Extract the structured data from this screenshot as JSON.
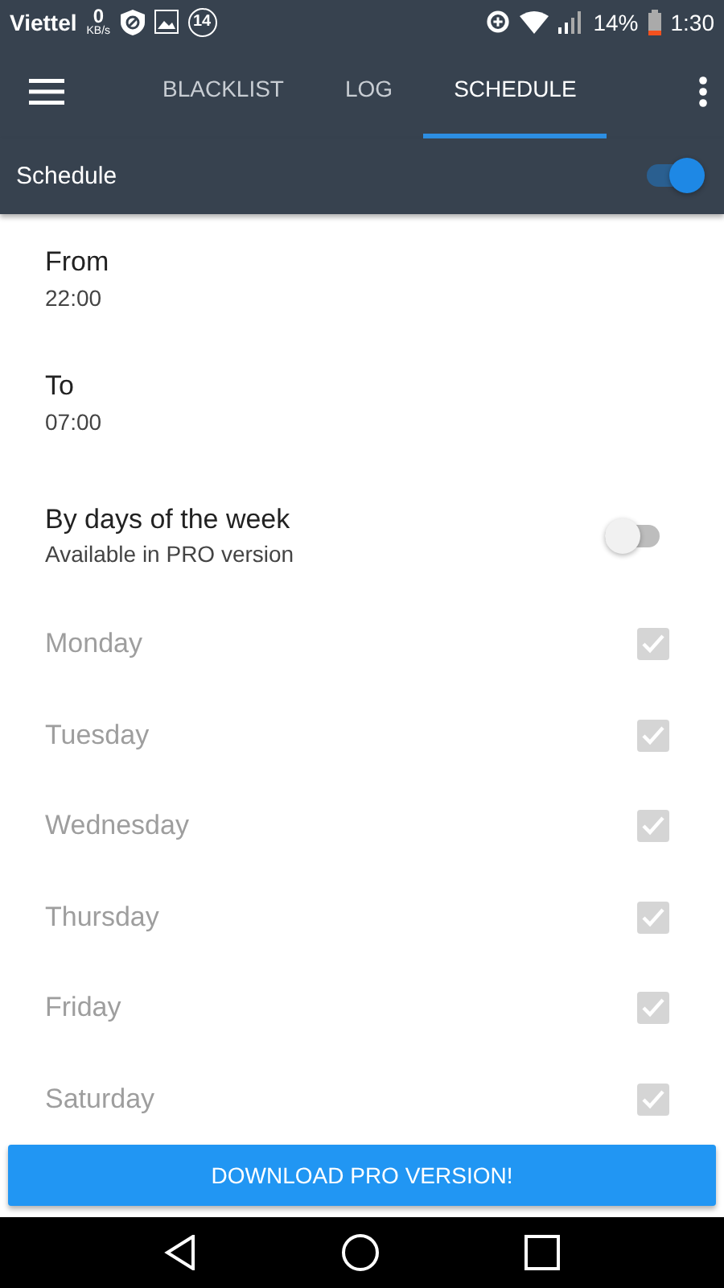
{
  "status_bar": {
    "carrier": "Viettel",
    "speed_value": "0",
    "speed_unit": "KB/s",
    "notification_count": "14",
    "battery": "14%",
    "time": "1:30"
  },
  "tabs": [
    {
      "label": "BLACKLIST",
      "selected": false
    },
    {
      "label": "LOG",
      "selected": false
    },
    {
      "label": "SCHEDULE",
      "selected": true
    }
  ],
  "schedule": {
    "label": "Schedule",
    "on": true
  },
  "times": [
    {
      "label": "From",
      "value": "22:00"
    },
    {
      "label": "To",
      "value": "07:00"
    }
  ],
  "by_days": {
    "label": "By days of the week",
    "note": "Available in PRO version",
    "on": false
  },
  "days": [
    {
      "label": "Monday",
      "checked": true,
      "disabled": true
    },
    {
      "label": "Tuesday",
      "checked": true,
      "disabled": true
    },
    {
      "label": "Wednesday",
      "checked": true,
      "disabled": true
    },
    {
      "label": "Thursday",
      "checked": true,
      "disabled": true
    },
    {
      "label": "Friday",
      "checked": true,
      "disabled": true
    },
    {
      "label": "Saturday",
      "checked": true,
      "disabled": true
    }
  ],
  "download_button": "DOWNLOAD PRO VERSION!"
}
